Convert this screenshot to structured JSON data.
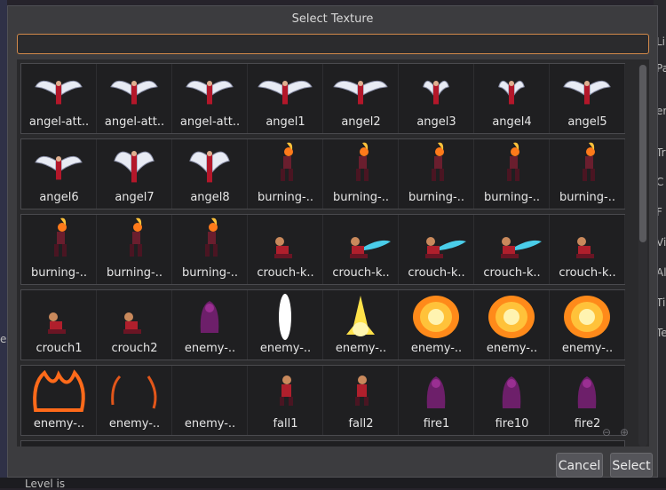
{
  "dialog": {
    "title": "Select Texture",
    "search_value": "",
    "buttons": {
      "cancel": "Cancel",
      "select": "Select"
    }
  },
  "background": {
    "right_edge": [
      "Li",
      "Pa",
      "er",
      "Tr",
      "C",
      "F",
      "Vi",
      "Al",
      "Ti",
      "Te"
    ],
    "left_edge": "es",
    "bottom_status": "Level is"
  },
  "textures": [
    [
      "angel-att..",
      "angel-att..",
      "angel-att..",
      "angel1",
      "angel2",
      "angel3",
      "angel4",
      "angel5"
    ],
    [
      "angel6",
      "angel7",
      "angel8",
      "burning-..",
      "burning-..",
      "burning-..",
      "burning-..",
      "burning-.."
    ],
    [
      "burning-..",
      "burning-..",
      "burning-..",
      "crouch-k..",
      "crouch-k..",
      "crouch-k..",
      "crouch-k..",
      "crouch-k.."
    ],
    [
      "crouch1",
      "crouch2",
      "enemy-..",
      "enemy-..",
      "enemy-..",
      "enemy-..",
      "enemy-..",
      "enemy-.."
    ],
    [
      "enemy-..",
      "enemy-..",
      "enemy-..",
      "fall1",
      "fall2",
      "fire1",
      "fire10",
      "fire2"
    ]
  ],
  "thumb_kinds": [
    [
      "angel",
      "angel",
      "angel",
      "angel-wide",
      "angel-wide",
      "angel-small",
      "angel-small",
      "angel"
    ],
    [
      "angel",
      "angel-tall",
      "angel-tall",
      "fire-warrior",
      "fire-warrior",
      "fire-warrior",
      "fire-warrior",
      "fire-warrior"
    ],
    [
      "fire-warrior",
      "fire-warrior",
      "fire-warrior",
      "crouch",
      "crouch-blue",
      "crouch-blue",
      "crouch-blue",
      "crouch"
    ],
    [
      "crouch",
      "crouch",
      "purple-enemy",
      "white-flame",
      "yellow-burst",
      "explosion",
      "explosion",
      "explosion"
    ],
    [
      "orange-fire",
      "orange-fire-sparse",
      "empty",
      "fall",
      "fall",
      "purple-enemy",
      "purple-enemy",
      "purple-enemy"
    ]
  ]
}
